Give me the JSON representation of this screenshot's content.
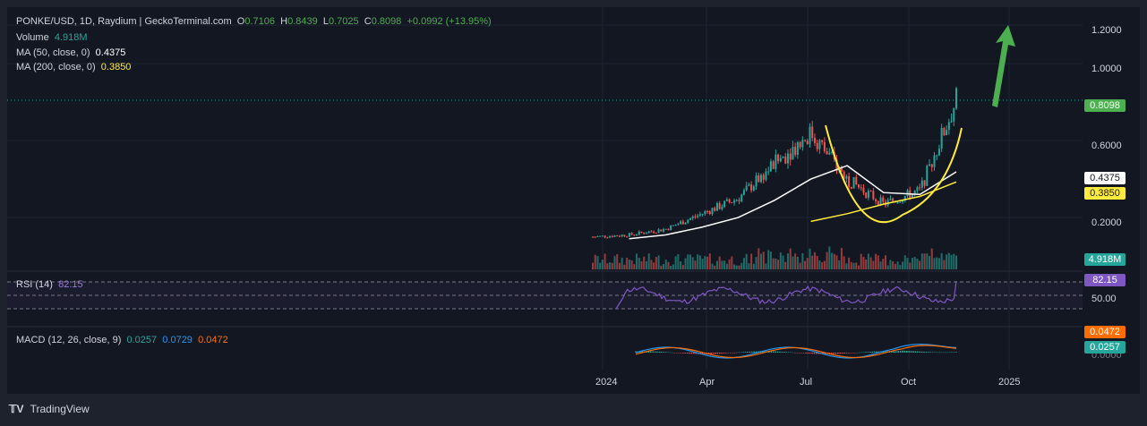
{
  "header": {
    "symbol": "PONKE/USD, 1D, Raydium | GeckoTerminal.com",
    "o_label": "O",
    "o_value": "0.7106",
    "h_label": "H",
    "h_value": "0.8439",
    "l_label": "L",
    "l_value": "0.7025",
    "c_label": "C",
    "c_value": "0.8098",
    "change": "+0.0992 (+13.95%)"
  },
  "legend": {
    "volume_label": "Volume",
    "volume_value": "4.918M",
    "ma50_label": "MA (50, close, 0)",
    "ma50_value": "0.4375",
    "ma200_label": "MA (200, close, 0)",
    "ma200_value": "0.3850"
  },
  "rsi": {
    "label": "RSI (14)",
    "value": "82.15",
    "tick": "50.00"
  },
  "macd": {
    "label": "MACD (12, 26, close, 9)",
    "macd_value": "0.0257",
    "signal_value": "0.0729",
    "hist_value": "0.0472"
  },
  "price_axis": {
    "ticks": [
      "1.2000",
      "1.0000",
      "0.6000",
      "0.2000"
    ],
    "last_price": "0.8098",
    "ma50": "0.4375",
    "ma200": "0.3850",
    "volume": "4.918M",
    "rsi": "82.15",
    "macd_hist": "0.0472",
    "macd_line": "0.0257",
    "macd_zero": "0.0000"
  },
  "time_axis": [
    "2024",
    "Apr",
    "Jul",
    "Oct",
    "2025"
  ],
  "brand": {
    "name": "TradingView"
  },
  "colors": {
    "background": "#131722",
    "up": "#26a69a",
    "down": "#ef5350",
    "ma50": "#ffffff",
    "ma200": "#ffeb3b",
    "rsi": "#7e57c2",
    "macd": "#2196f3",
    "signal": "#ff6d00",
    "arrow": "#4caf50"
  },
  "chart_data": {
    "type": "line",
    "title": "PONKE/USD, 1D, Raydium | GeckoTerminal.com",
    "ylim": [
      0.1,
      1.3
    ],
    "x": [
      "2024-01",
      "2024-02",
      "2024-03",
      "2024-04",
      "2024-05",
      "2024-06",
      "2024-07",
      "2024-08",
      "2024-09",
      "2024-10",
      "2024-11"
    ],
    "series": [
      {
        "name": "Close",
        "values": [
          0.1,
          0.11,
          0.14,
          0.22,
          0.3,
          0.48,
          0.64,
          0.4,
          0.27,
          0.34,
          0.81
        ]
      },
      {
        "name": "MA (50, close, 0)",
        "values": [
          null,
          0.09,
          0.11,
          0.15,
          0.2,
          0.29,
          0.4,
          0.47,
          0.33,
          0.32,
          0.4375
        ]
      },
      {
        "name": "MA (200, close, 0)",
        "values": [
          null,
          null,
          null,
          null,
          null,
          null,
          0.18,
          0.22,
          0.27,
          0.31,
          0.385
        ]
      }
    ],
    "last": {
      "open": 0.7106,
      "high": 0.8439,
      "low": 0.7025,
      "close": 0.8098
    },
    "rsi_last": 82.15,
    "volume_last": "4.918M"
  }
}
